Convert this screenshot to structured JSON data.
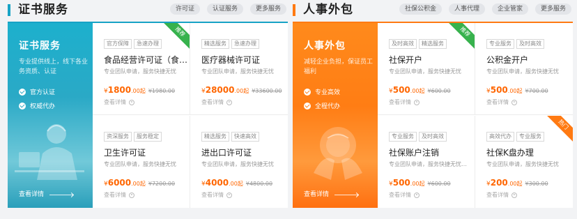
{
  "sections": [
    {
      "title": "证书服务",
      "accent": "#17a3c5",
      "links": [
        "许可证",
        "认证服务",
        "更多服务"
      ],
      "banner": {
        "title": "证书服务",
        "subtitle": "专业提供线上，线下各业务资质、认证",
        "features": [
          "官方认证",
          "权威代办"
        ],
        "more": "查看详情"
      },
      "cards": [
        {
          "tags": [
            "官方保障",
            "急速办理"
          ],
          "title": "食品经营许可证（食…",
          "desc": "专业团队申请，服务快捷无忧",
          "price": "1800",
          "unit": ".00起",
          "old": "¥1980.00",
          "detail": "查看详情",
          "ribbon": "推荐"
        },
        {
          "tags": [
            "精选服务",
            "急速办理"
          ],
          "title": "医疗器械许可证",
          "desc": "专业团队申请，服务快捷无忧",
          "price": "28000",
          "unit": ".00起",
          "old": "¥33600.00",
          "detail": "查看详情",
          "ribbon": ""
        },
        {
          "tags": [
            "资深服务",
            "服务稳定"
          ],
          "title": "卫生许可证",
          "desc": "专业团队申请，服务快捷无忧",
          "price": "6000",
          "unit": ".00起",
          "old": "¥7200.00",
          "detail": "查看详情",
          "ribbon": ""
        },
        {
          "tags": [
            "精选服务",
            "快速高效"
          ],
          "title": "进出口许可证",
          "desc": "专业团队申请，服务快捷无忧",
          "price": "4000",
          "unit": ".00起",
          "old": "¥4800.00",
          "detail": "查看详情",
          "ribbon": ""
        }
      ]
    },
    {
      "title": "人事外包",
      "accent": "#ff7a12",
      "links": [
        "社保公积金",
        "人事代理",
        "企业管家",
        "更多服务"
      ],
      "banner": {
        "title": "人事外包",
        "subtitle": "减轻企业负担，保证员工福利",
        "features": [
          "专业高效",
          "全程代办"
        ],
        "more": "查看详情"
      },
      "cards": [
        {
          "tags": [
            "及时高效",
            "精选服务"
          ],
          "title": "社保开户",
          "desc": "专业团队申请，服务快捷无忧",
          "price": "500",
          "unit": ".00起",
          "old": "¥600.00",
          "detail": "查看详情",
          "ribbon": "推荐"
        },
        {
          "tags": [
            "专业服务",
            "及时高效"
          ],
          "title": "公积金开户",
          "desc": "专业团队申请，服务快捷无忧",
          "price": "500",
          "unit": ".00起",
          "old": "¥700.00",
          "detail": "查看详情",
          "ribbon": ""
        },
        {
          "tags": [
            "专业服务",
            "及时高效"
          ],
          "title": "社保账户注销",
          "desc": "专业团队申请，服务快捷无忧…",
          "price": "500",
          "unit": ".00起",
          "old": "¥600.00",
          "detail": "查看详情",
          "ribbon": ""
        },
        {
          "tags": [
            "高效代办",
            "专业服务"
          ],
          "title": "社保K盘办理",
          "desc": "专业团队申请，服务快捷无忧",
          "price": "200",
          "unit": ".00起",
          "old": "¥300.00",
          "detail": "查看详情",
          "ribbon": "热门"
        }
      ]
    }
  ],
  "currency": "¥",
  "colors": {
    "teal": "#17a3c5",
    "orange": "#ff7a12",
    "price": "#ff6600",
    "ribbon_recommend": "#37b24d",
    "ribbon_hot": "#ff7a12"
  }
}
